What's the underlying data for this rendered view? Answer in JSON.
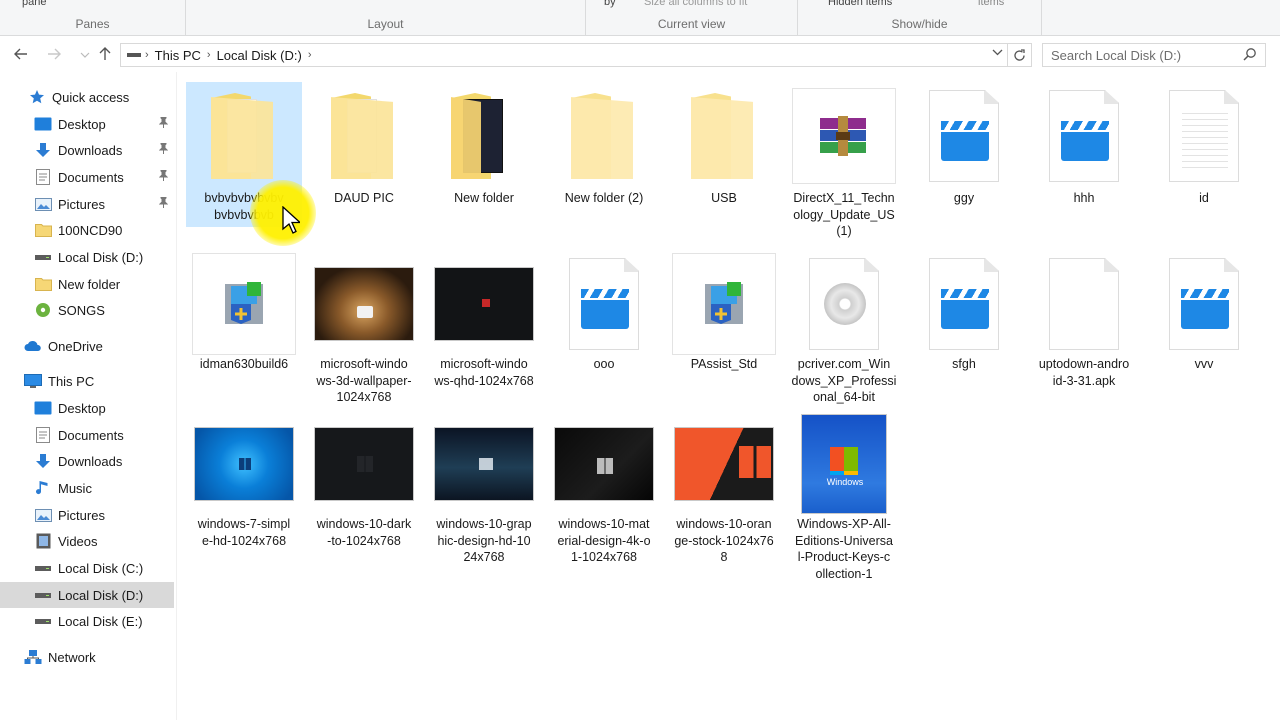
{
  "ribbon": {
    "panes_label": "Panes",
    "layout_label": "Layout",
    "current_view_label": "Current view",
    "show_hide_label": "Show/hide",
    "pane_tiny": "pane",
    "sort_by_tiny": "by",
    "size_columns_tiny": "Size all columns to fit",
    "hidden_items_tiny": "Hidden items",
    "items_tiny": "items"
  },
  "address": {
    "crumbs": [
      "This PC",
      "Local Disk (D:)"
    ]
  },
  "search": {
    "placeholder": "Search Local Disk (D:)"
  },
  "sidebar": {
    "items": [
      {
        "label": "Quick access",
        "icon": "star-icon"
      },
      {
        "label": "Desktop",
        "icon": "desktop-icon"
      },
      {
        "label": "Downloads",
        "icon": "download-icon"
      },
      {
        "label": "Documents",
        "icon": "documents-icon"
      },
      {
        "label": "Pictures",
        "icon": "pictures-icon"
      },
      {
        "label": "100NCD90",
        "icon": "folder-icon"
      },
      {
        "label": "Local Disk (D:)",
        "icon": "drive-icon"
      },
      {
        "label": "New folder",
        "icon": "folder-icon"
      },
      {
        "label": "SONGS",
        "icon": "music-disc-icon"
      },
      {
        "label": "OneDrive",
        "icon": "cloud-icon"
      },
      {
        "label": "This PC",
        "icon": "computer-icon"
      },
      {
        "label": "Desktop",
        "icon": "desktop-icon"
      },
      {
        "label": "Documents",
        "icon": "documents-icon"
      },
      {
        "label": "Downloads",
        "icon": "download-icon"
      },
      {
        "label": "Music",
        "icon": "music-icon"
      },
      {
        "label": "Pictures",
        "icon": "pictures-icon"
      },
      {
        "label": "Videos",
        "icon": "videos-icon"
      },
      {
        "label": "Local Disk (C:)",
        "icon": "drive-icon"
      },
      {
        "label": "Local Disk (D:)",
        "icon": "drive-icon"
      },
      {
        "label": "Local Disk (E:)",
        "icon": "drive-icon"
      },
      {
        "label": "Network",
        "icon": "network-icon"
      }
    ]
  },
  "files": [
    {
      "name": "bvbvbvbvbvbvbvbvbvbvbvbvb",
      "type": "folder-doc",
      "selected": true
    },
    {
      "name": "DAUD PIC",
      "type": "folder-doc"
    },
    {
      "name": "New folder",
      "type": "folder-dark"
    },
    {
      "name": "New folder (2)",
      "type": "folder-empty"
    },
    {
      "name": "USB",
      "type": "folder-empty"
    },
    {
      "name": "DirectX_11_Technology_Update_US (1)",
      "type": "winrar"
    },
    {
      "name": "ggy",
      "type": "video"
    },
    {
      "name": "hhh",
      "type": "video"
    },
    {
      "name": "id",
      "type": "text"
    },
    {
      "name": "idman630build6",
      "type": "installer"
    },
    {
      "name": "microsoft-windows-3d-wallpaper-1024x768",
      "type": "img-3d"
    },
    {
      "name": "microsoft-windows-qhd-1024x768",
      "type": "img-qhd"
    },
    {
      "name": "ooo",
      "type": "video"
    },
    {
      "name": "PAssist_Std",
      "type": "installer"
    },
    {
      "name": "pcriver.com_Windows_XP_Professional_64-bit",
      "type": "disc"
    },
    {
      "name": "sfgh",
      "type": "video"
    },
    {
      "name": "uptodown-android-3-31.apk",
      "type": "blank"
    },
    {
      "name": "vvv",
      "type": "video"
    },
    {
      "name": "windows-7-simple-hd-1024x768",
      "type": "img-win7"
    },
    {
      "name": "windows-10-dark-to-1024x768",
      "type": "img-dark"
    },
    {
      "name": "windows-10-graphic-design-hd-1024x768",
      "type": "img-graphic"
    },
    {
      "name": "windows-10-material-design-4k-o1-1024x768",
      "type": "img-material"
    },
    {
      "name": "windows-10-orange-stock-1024x768",
      "type": "img-orange"
    },
    {
      "name": "Windows-XP-All-Editions-Universal-Product-Keys-collection-1",
      "type": "img-xp"
    }
  ],
  "display_names": [
    "bvbvbvbvbvbv\nbvbvbvbvb",
    "DAUD PIC",
    "New folder",
    "New folder (2)",
    "USB",
    "DirectX_11_Techn\nology_Update_US\n(1)",
    "ggy",
    "hhh",
    "id",
    "idman630build6",
    "microsoft-windo\nws-3d-wallpaper-\n1024x768",
    "microsoft-windo\nws-qhd-1024x768",
    "ooo",
    "PAssist_Std",
    "pcriver.com_Win\ndows_XP_Professi\nonal_64-bit",
    "sfgh",
    "uptodown-andro\nid-3-31.apk",
    "vvv",
    "windows-7-simpl\ne-hd-1024x768",
    "windows-10-dark\n-to-1024x768",
    "windows-10-grap\nhic-design-hd-10\n24x768",
    "windows-10-mat\nerial-design-4k-o\n1-1024x768",
    "windows-10-oran\nge-stock-1024x76\n8",
    "Windows-XP-All-\nEditions-Universa\nl-Product-Keys-c\nollection-1"
  ],
  "colors": {
    "selection": "#cce8ff",
    "sidebar_selected": "#d9d9d9",
    "accent_blue": "#1e88e5",
    "folder_yellow": "#fbe49a"
  }
}
